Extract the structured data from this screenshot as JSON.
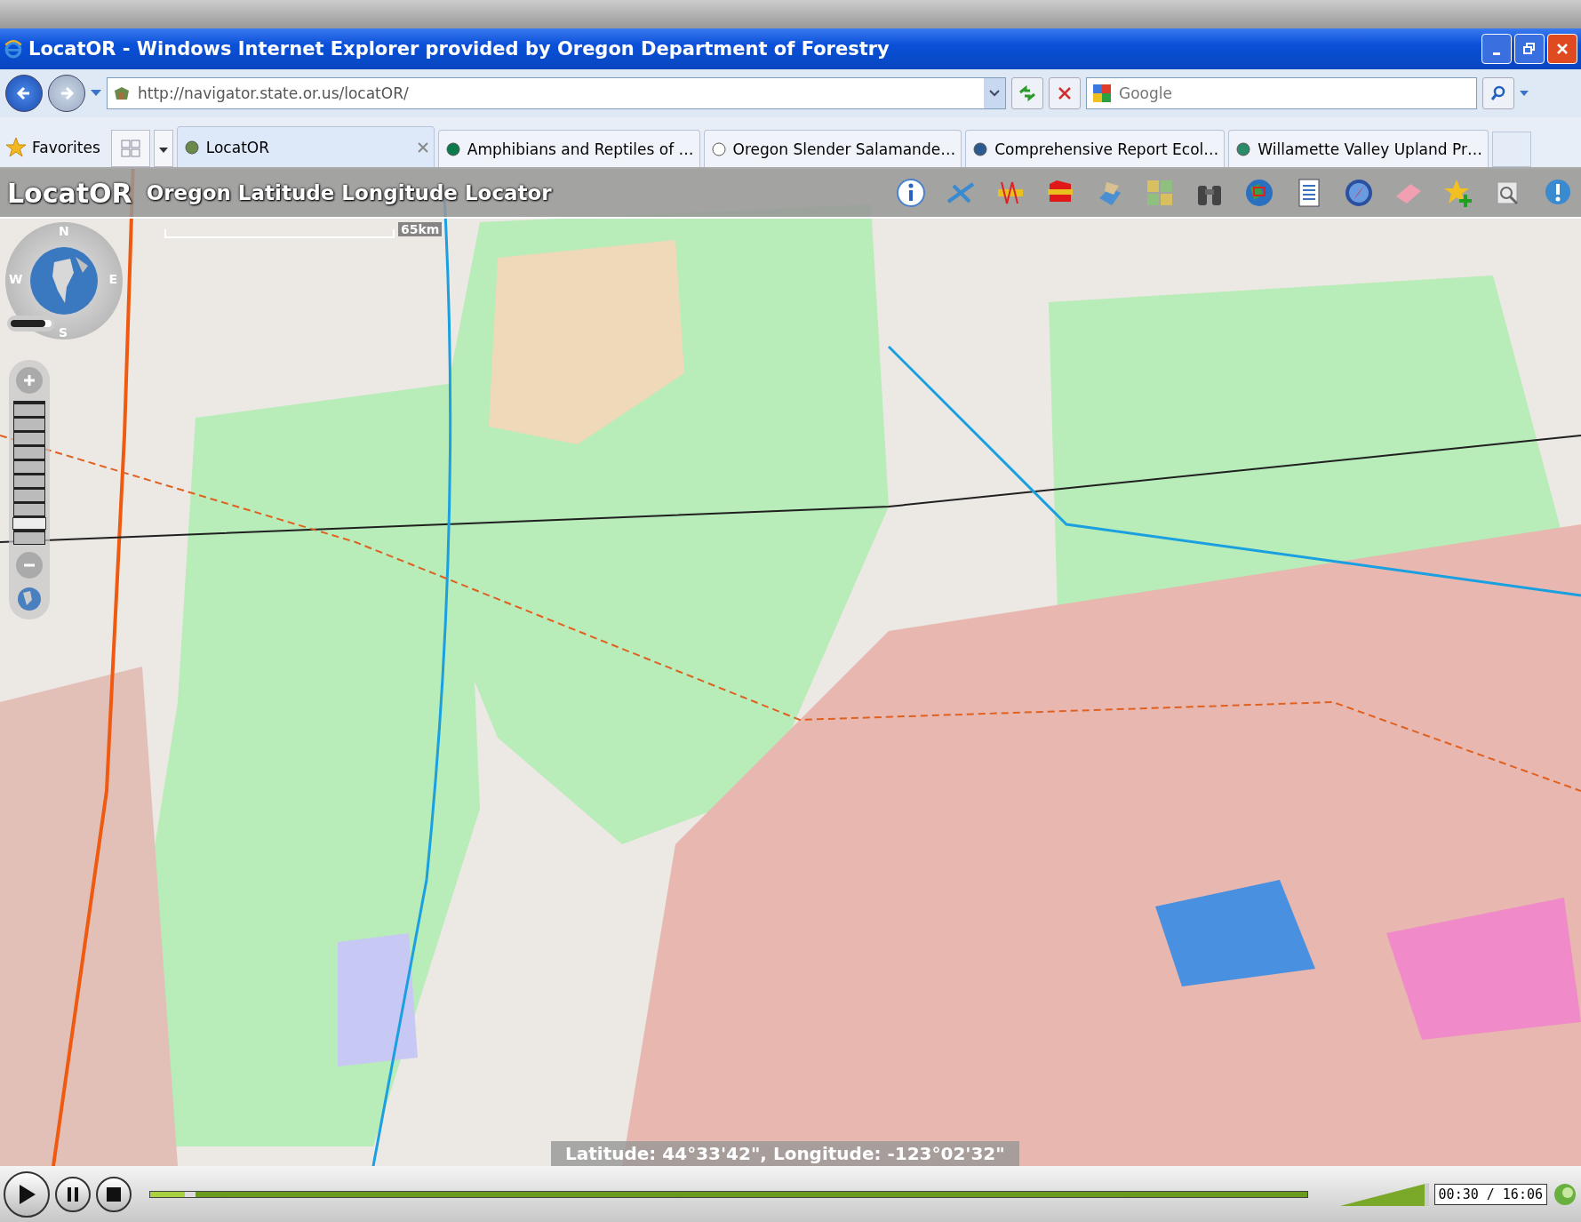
{
  "window": {
    "title": "LocatOR - Windows Internet Explorer provided by Oregon Department of Forestry"
  },
  "address_bar": {
    "value": "http://navigator.state.or.us/locatOR/"
  },
  "search": {
    "placeholder": "Google"
  },
  "favorites": {
    "label": "Favorites"
  },
  "tabs": [
    {
      "label": "LocatOR",
      "selected": true
    },
    {
      "label": "Amphibians and Reptiles of …",
      "selected": false
    },
    {
      "label": "Oregon Slender Salamande…",
      "selected": false
    },
    {
      "label": "Comprehensive Report Ecol…",
      "selected": false
    },
    {
      "label": "Willamette Valley Upland Pr…",
      "selected": false
    }
  ],
  "app": {
    "title": "LocatOR",
    "subtitle": "Oregon Latitude Longitude Locator"
  },
  "compass": {
    "north": "N",
    "east": "E",
    "south": "S",
    "west": "W"
  },
  "opacity_slider": {
    "level": 0.85
  },
  "zoom_slider": {
    "level": 0.1
  },
  "scale_bar": {
    "label": "65km"
  },
  "coordinates": "Latitude: 44°33'42\", Longitude: -123°02'32\"",
  "player": {
    "progress": {
      "level": 0.03
    },
    "volume": {
      "level": 0.95
    },
    "time": "00:30 / 16:06"
  }
}
